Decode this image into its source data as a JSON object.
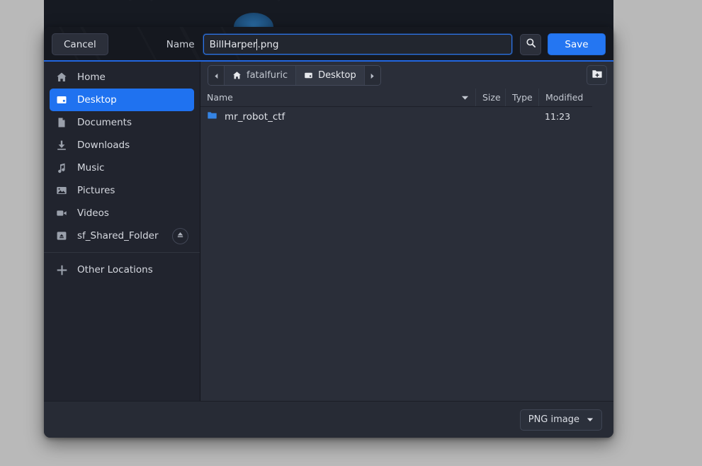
{
  "window_behind": {
    "present": true,
    "logo": "blue-ellipse-logo"
  },
  "dialog": {
    "header": {
      "cancel_label": "Cancel",
      "name_label": "Name",
      "filename_before_caret": "BillHarper",
      "filename_after_caret": ".png",
      "filename_value": "BillHarper.png",
      "search_icon": "search-icon",
      "save_label": "Save"
    },
    "sidebar": {
      "items": [
        {
          "label": "Home",
          "icon": "home-icon",
          "selected": false
        },
        {
          "label": "Desktop",
          "icon": "desktop-icon",
          "selected": true
        },
        {
          "label": "Documents",
          "icon": "document-icon",
          "selected": false
        },
        {
          "label": "Downloads",
          "icon": "download-icon",
          "selected": false
        },
        {
          "label": "Music",
          "icon": "music-note-icon",
          "selected": false
        },
        {
          "label": "Pictures",
          "icon": "picture-icon",
          "selected": false
        },
        {
          "label": "Videos",
          "icon": "video-camera-icon",
          "selected": false
        },
        {
          "label": "sf_Shared_Folder",
          "icon": "drive-icon",
          "selected": false,
          "eject": "eject-icon"
        }
      ],
      "other_locations": {
        "label": "Other Locations",
        "icon": "plus-icon"
      }
    },
    "pathbar": {
      "back_icon": "chevron-left-icon",
      "forward_icon": "chevron-right-icon",
      "crumbs": [
        {
          "label": "fatalfuric",
          "icon": "home-icon",
          "active": false
        },
        {
          "label": "Desktop",
          "icon": "desktop-icon",
          "active": true
        }
      ],
      "new_folder_icon": "new-folder-icon"
    },
    "file_list": {
      "columns": [
        {
          "key": "name",
          "label": "Name",
          "sort": "descending"
        },
        {
          "key": "size",
          "label": "Size"
        },
        {
          "key": "type",
          "label": "Type"
        },
        {
          "key": "modified",
          "label": "Modified"
        }
      ],
      "rows": [
        {
          "name": "mr_robot_ctf",
          "icon": "folder-icon",
          "size": "",
          "type": "",
          "modified": "11:23"
        }
      ]
    },
    "actionbar": {
      "filter_label": "PNG image",
      "filter_chevron": "chevron-down-icon"
    }
  },
  "colors": {
    "accent_blue": "#2476f2",
    "selection_blue": "#1f72f0",
    "folder_blue": "#3584e4",
    "header_bg": "#15181f",
    "sidebar_bg": "#21242e",
    "pane_bg": "#2a2e39",
    "desktop_bg": "#b9b9b9"
  }
}
